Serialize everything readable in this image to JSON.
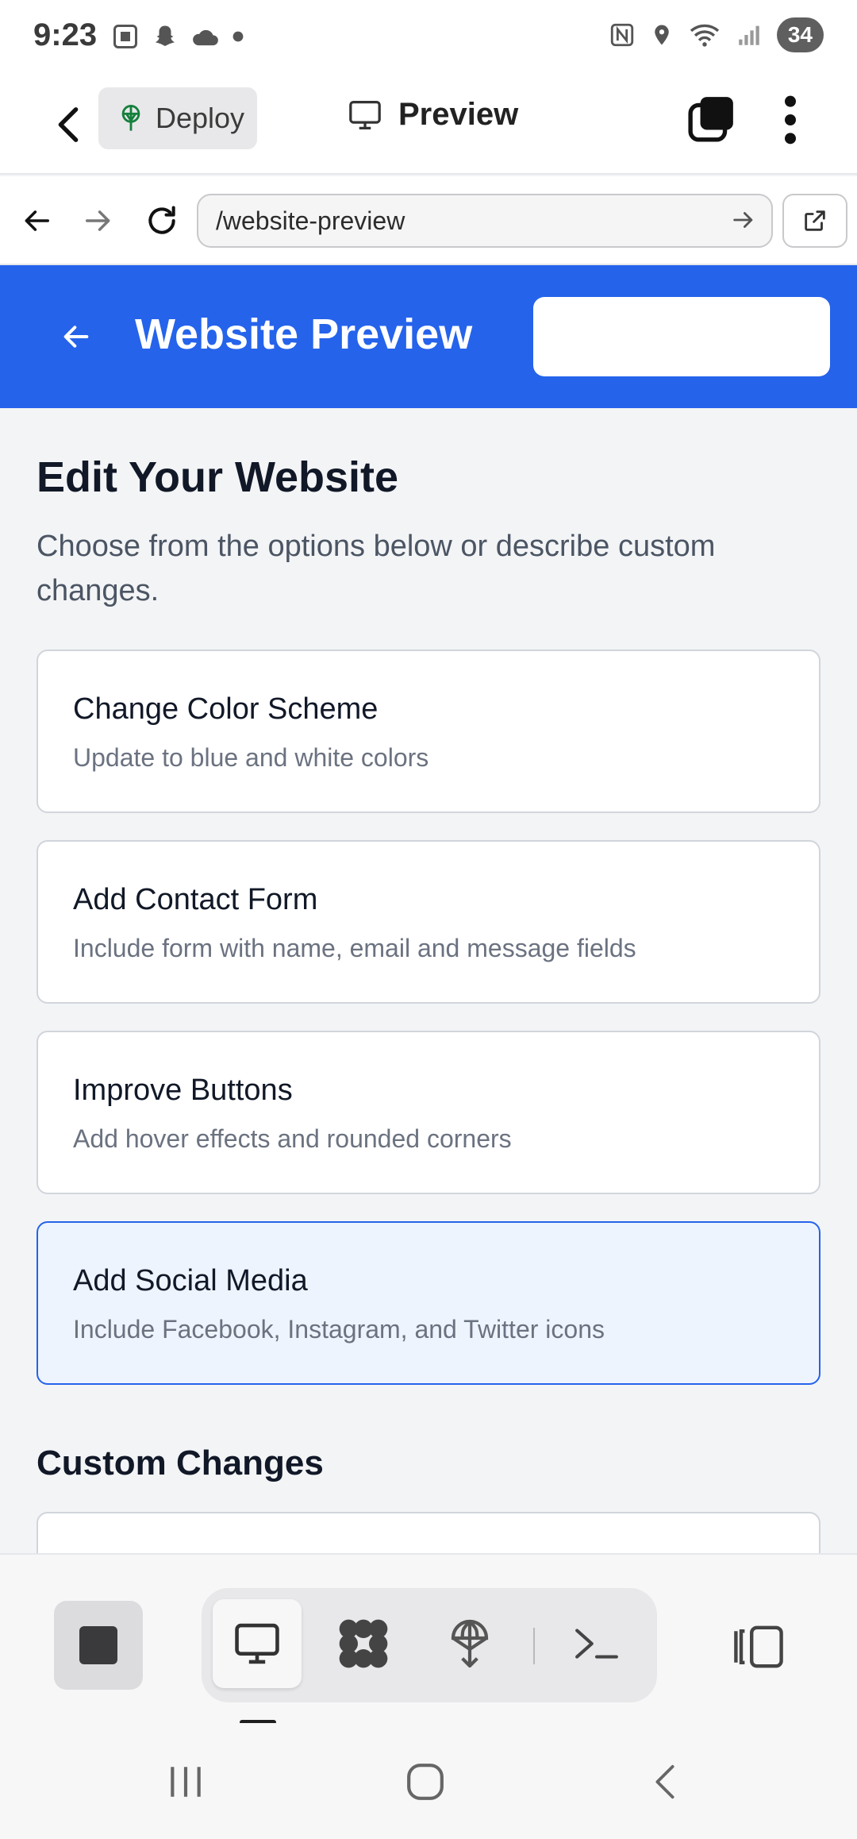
{
  "status_bar": {
    "time": "9:23",
    "battery": "34",
    "left_icons": [
      "screenshot-icon",
      "snapchat-icon",
      "cloud-icon",
      "dot-icon"
    ],
    "right_icons": [
      "nfc-icon",
      "location-icon",
      "wifi-icon",
      "signal-icon"
    ]
  },
  "app_bar": {
    "deploy_label": "Deploy",
    "preview_label": "Preview"
  },
  "url_bar": {
    "url": "/website-preview"
  },
  "site_header": {
    "title": "Website Preview"
  },
  "content": {
    "heading": "Edit Your Website",
    "subheading": "Choose from the options below or describe custom changes.",
    "options": [
      {
        "title": "Change Color Scheme",
        "description": "Update to blue and white colors"
      },
      {
        "title": "Add Contact Form",
        "description": "Include form with name, email and message fields"
      },
      {
        "title": "Improve Buttons",
        "description": "Add hover effects and rounded corners"
      },
      {
        "title": "Add Social Media",
        "description": "Include Facebook, Instagram, and Twitter icons",
        "selected": true
      }
    ],
    "custom_heading": "Custom Changes"
  },
  "toolbar": {
    "items": [
      "stop-icon",
      "desktop-icon",
      "apps-icon",
      "deploy-icon",
      "terminal-icon",
      "panel-icon"
    ],
    "active": "desktop-icon"
  },
  "colors": {
    "accent": "#2563eb",
    "selected_bg": "#eef4fe",
    "deploy_green": "#15803d"
  }
}
